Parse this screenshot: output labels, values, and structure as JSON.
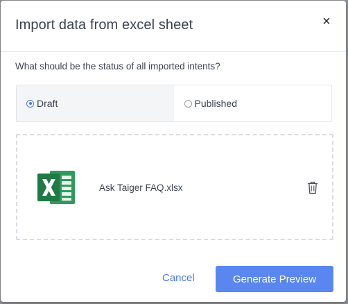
{
  "dialog": {
    "title": "Import data from excel sheet",
    "close_label": "×"
  },
  "status": {
    "question": "What should be the status of all imported intents?",
    "options": [
      {
        "label": "Draft",
        "selected": true
      },
      {
        "label": "Published",
        "selected": false
      }
    ]
  },
  "upload": {
    "file_name": "Ask Taiger FAQ.xlsx",
    "file_icon": "excel-file-icon",
    "delete_icon": "trash-icon"
  },
  "footer": {
    "cancel_label": "Cancel",
    "primary_label": "Generate Preview"
  },
  "colors": {
    "accent": "#5a86f0",
    "excel_green": "#1f7a45"
  }
}
